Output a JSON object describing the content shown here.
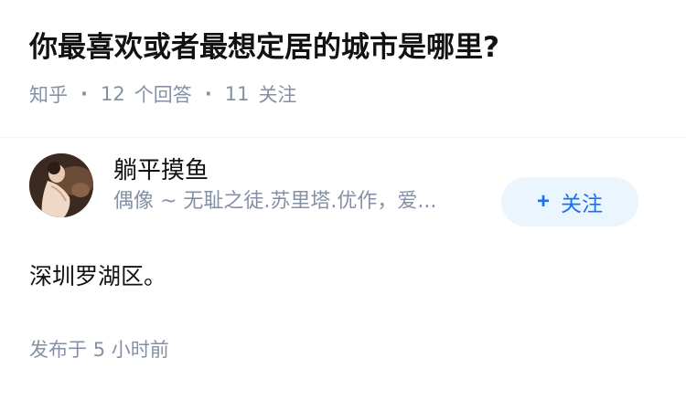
{
  "question": {
    "title": "你最喜欢或者最想定居的城市是哪里?",
    "source": "知乎",
    "answer_count": "12",
    "answer_label": "个回答",
    "follower_count": "11",
    "follower_label": "关注"
  },
  "answer": {
    "author_name": "躺平摸鱼",
    "author_bio": "偶像 ~ 无耻之徒.苏里塔.优作，爱...",
    "follow_label": "关注",
    "follow_icon": "plus-icon",
    "content": "深圳罗湖区。",
    "publish_prefix": "发布于",
    "publish_number": "5",
    "publish_unit": "小时前"
  },
  "colors": {
    "meta_gray": "#8590a6",
    "follow_bg": "#ebf5fd",
    "follow_text": "#1772f6"
  }
}
